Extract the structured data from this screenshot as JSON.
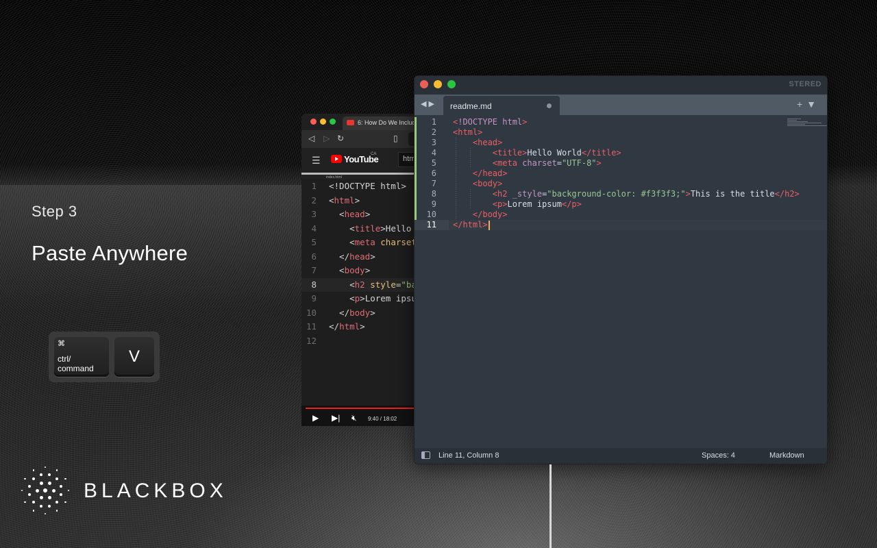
{
  "slide": {
    "step_label": "Step 3",
    "headline": "Paste Anywhere",
    "keys": {
      "modifier_symbol": "⌘",
      "modifier_label": "ctrl/\ncommand",
      "key": "V"
    },
    "brand": {
      "wordmark": "BLACKBOX"
    }
  },
  "youtube_window": {
    "tab_title": "6: How Do We Includ",
    "site_name": "YouTube",
    "region": "CA",
    "search_text": "htm",
    "file_tab": "index.html",
    "code_lines": [
      {
        "n": "1",
        "segments": [
          [
            "p",
            "<!DOCTYPE html>"
          ]
        ]
      },
      {
        "n": "2",
        "segments": [
          [
            "p",
            "<"
          ],
          [
            "tag",
            "html"
          ],
          [
            "p",
            ">"
          ]
        ]
      },
      {
        "n": "3",
        "segments": [
          [
            "p",
            "  <"
          ],
          [
            "tag",
            "head"
          ],
          [
            "p",
            ">"
          ]
        ]
      },
      {
        "n": "4",
        "segments": [
          [
            "p",
            "    <"
          ],
          [
            "tag",
            "title"
          ],
          [
            "p",
            ">Hello"
          ]
        ]
      },
      {
        "n": "5",
        "segments": [
          [
            "p",
            "    <"
          ],
          [
            "tag",
            "meta"
          ],
          [
            "att",
            " charset"
          ]
        ]
      },
      {
        "n": "6",
        "segments": [
          [
            "p",
            "  </"
          ],
          [
            "tag",
            "head"
          ],
          [
            "p",
            ">"
          ]
        ]
      },
      {
        "n": "7",
        "segments": [
          [
            "p",
            "  <"
          ],
          [
            "tag",
            "body"
          ],
          [
            "p",
            ">"
          ]
        ]
      },
      {
        "n": "8",
        "segments": [
          [
            "p",
            "    <"
          ],
          [
            "tag",
            "h2"
          ],
          [
            "att",
            " style"
          ],
          [
            "p",
            "="
          ],
          [
            "str",
            "\"ba"
          ]
        ]
      },
      {
        "n": "9",
        "segments": [
          [
            "p",
            "    <"
          ],
          [
            "tag",
            "p"
          ],
          [
            "p",
            ">Lorem ipsu"
          ]
        ]
      },
      {
        "n": "10",
        "segments": [
          [
            "p",
            "  </"
          ],
          [
            "tag",
            "body"
          ],
          [
            "p",
            ">"
          ]
        ]
      },
      {
        "n": "11",
        "segments": [
          [
            "p",
            "</"
          ],
          [
            "tag",
            "html"
          ],
          [
            "p",
            ">"
          ]
        ]
      },
      {
        "n": "12",
        "segments": []
      }
    ],
    "highlighted_line": "8",
    "player": {
      "time": "9:40 / 18:02",
      "progress": 1.0
    }
  },
  "editor_window": {
    "window_title": "STERED",
    "tab_filename": "readme.md",
    "code_lines": [
      {
        "n": "1",
        "segments": [
          [
            "t",
            "<"
          ],
          [
            "a",
            "!DOCTYPE html"
          ],
          [
            "t",
            ">"
          ]
        ]
      },
      {
        "n": "2",
        "segments": [
          [
            "t",
            "<"
          ],
          [
            "t",
            "html"
          ],
          [
            "t",
            ">"
          ]
        ]
      },
      {
        "n": "3",
        "segments": [
          [
            "p",
            "    "
          ],
          [
            "t",
            "<head>"
          ]
        ]
      },
      {
        "n": "4",
        "segments": [
          [
            "p",
            "        "
          ],
          [
            "t",
            "<title>"
          ],
          [
            "p",
            "Hello World"
          ],
          [
            "t",
            "</title>"
          ]
        ]
      },
      {
        "n": "5",
        "segments": [
          [
            "p",
            "        "
          ],
          [
            "t",
            "<meta"
          ],
          [
            "a",
            " charset"
          ],
          [
            "p",
            "="
          ],
          [
            "s",
            "\"UTF-8\""
          ],
          [
            "t",
            ">"
          ]
        ]
      },
      {
        "n": "6",
        "segments": [
          [
            "p",
            "    "
          ],
          [
            "t",
            "</head>"
          ]
        ]
      },
      {
        "n": "7",
        "segments": [
          [
            "p",
            "    "
          ],
          [
            "t",
            "<body>"
          ]
        ]
      },
      {
        "n": "8",
        "segments": [
          [
            "p",
            "        "
          ],
          [
            "t",
            "<h2"
          ],
          [
            "a",
            " _style"
          ],
          [
            "p",
            "="
          ],
          [
            "s",
            "\"background-color: #f3f3f3;\""
          ],
          [
            "t",
            ">"
          ],
          [
            "p",
            "This is the title"
          ],
          [
            "t",
            "</h2>"
          ]
        ]
      },
      {
        "n": "9",
        "segments": [
          [
            "p",
            "        "
          ],
          [
            "t",
            "<p>"
          ],
          [
            "p",
            "Lorem ipsum"
          ],
          [
            "t",
            "</p>"
          ]
        ]
      },
      {
        "n": "10",
        "segments": [
          [
            "p",
            "    "
          ],
          [
            "t",
            "</body>"
          ]
        ]
      },
      {
        "n": "11",
        "segments": [
          [
            "t",
            "</html>"
          ]
        ]
      }
    ],
    "current_line": "11",
    "status": {
      "position": "Line 11, Column 8",
      "indent": "Spaces: 4",
      "syntax": "Markdown"
    }
  }
}
